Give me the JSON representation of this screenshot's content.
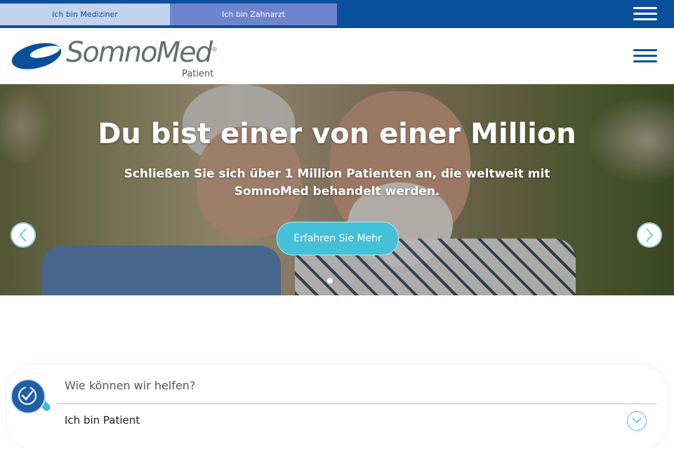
{
  "topbar": {
    "tab_mediziner": "Ich bin Mediziner",
    "tab_zahnarzt": "Ich bin Zahnarzt"
  },
  "header": {
    "logo_text": "SomnoMed",
    "logo_registered": "®",
    "logo_sub": "Patient"
  },
  "hero": {
    "title": "Du bist einer von einer Million",
    "subtitle": "Schließen Sie sich über 1 Million Patienten an, die weltweit mit SomnoMed behandelt werden.",
    "cta_label": "Erfahren Sie Mehr"
  },
  "help": {
    "title": "Wie können wir helfen?",
    "option_label": "Ich bin Patient"
  },
  "icons": {
    "menu": "hamburger-icon",
    "prev": "chevron-left-icon",
    "next": "chevron-right-icon",
    "expand": "chevron-down-icon",
    "accessibility": "accessibility-icon"
  },
  "colors": {
    "brand_blue": "#0a4f9c",
    "accent_teal": "#44c0d8",
    "tab_active_bg": "#c3d3ee",
    "tab_inactive_bg": "#6e84cf"
  }
}
